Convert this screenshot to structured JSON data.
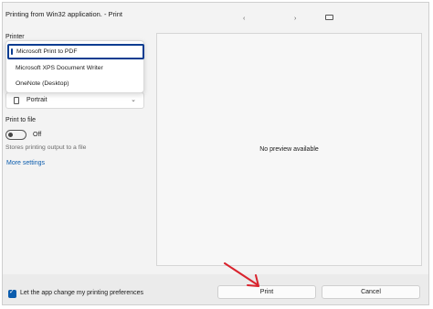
{
  "window": {
    "title": "Printing from Win32 application. - Print"
  },
  "toolbar": {
    "prev_icon": "‹",
    "next_icon": "›"
  },
  "printer": {
    "label": "Printer",
    "options": [
      "Microsoft Print to PDF",
      "Microsoft XPS Document Writer",
      "OneNote (Desktop)"
    ],
    "selected": "Microsoft Print to PDF"
  },
  "orientation": {
    "value": "Portrait"
  },
  "print_to_file": {
    "label": "Print to file",
    "state": "Off",
    "hint": "Stores printing output to a file"
  },
  "more_settings": "More settings",
  "preview": {
    "message": "No preview available"
  },
  "footer": {
    "checkbox_label": "Let the app change my printing preferences",
    "checkbox_checked": true,
    "print_label": "Print",
    "cancel_label": "Cancel"
  },
  "colors": {
    "accent": "#0b3d91",
    "link": "#0b5cad",
    "annotation_arrow": "#d9232d"
  }
}
